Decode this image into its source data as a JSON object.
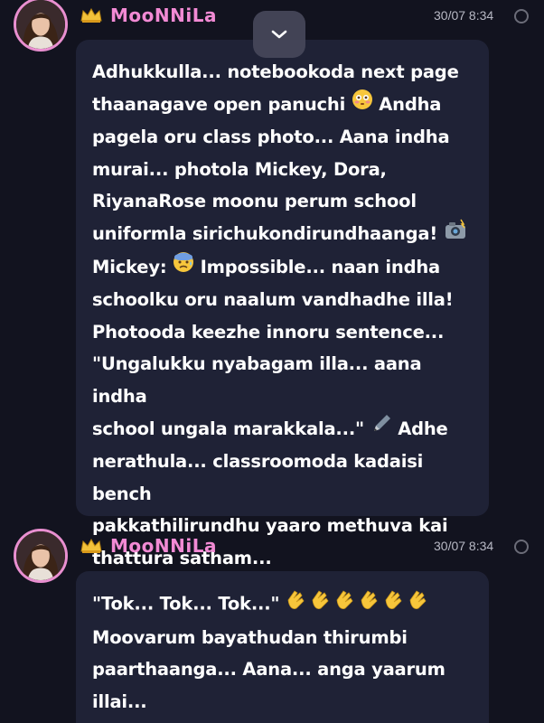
{
  "messages": [
    {
      "author": "MooNNiLa",
      "timestamp": "30/07 8:34",
      "lines": [
        "Adhukkulla... notebookoda next page",
        "thaanagave open panuchi",
        "pagela oru class photo... Aana indha",
        "murai... photola Mickey, Dora,",
        "RiyanaRose moonu perum school",
        "uniformla sirichukondirundhaanga!",
        "Mickey:",
        "schoolku oru naalum vandhadhe illa!",
        "Photooda keezhe innoru sentence...",
        "\"Ungalukku nyabagam illa... aana indha",
        "school ungala marakkala...\"",
        "nerathula... classroomoda kadaisi bench",
        "pakkathilirundhu yaaro methuva kai",
        "thattura satham..."
      ],
      "inline": {
        "line2_after": "Andha",
        "line7_after": "Impossible... naan indha",
        "line11_after": "Adhe"
      }
    },
    {
      "author": "MooNNiLa",
      "timestamp": "30/07 8:34",
      "lines": [
        "\"Tok... Tok... Tok...\"",
        "Moovarum bayathudan thirumbi",
        "paarthaanga... Aana... anga yaarum",
        "illai..."
      ]
    }
  ],
  "icons": {
    "crown": "crown-icon",
    "flushed": "flushed-face-emoji",
    "camera": "camera-flash-emoji",
    "fearful": "anxious-sweat-face-emoji",
    "pen": "pen-emoji",
    "clap": "clapping-hands-emoji",
    "scroll": "chevron-down-icon"
  },
  "colors": {
    "background": "#12131f",
    "bubble": "#1f2236",
    "name": "#f28ad4",
    "avatar_ring": "#e98fd0"
  }
}
